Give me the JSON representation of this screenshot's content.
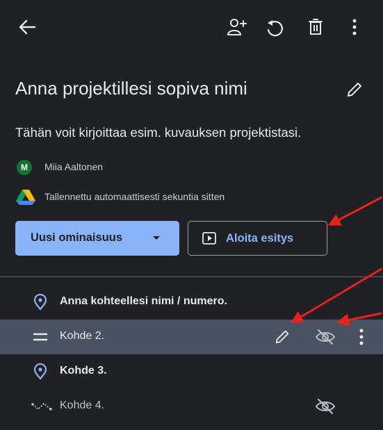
{
  "project": {
    "title": "Anna projektillesi sopiva nimi",
    "description": "Tähän voit kirjoittaa esim. kuvauksen projektistasi.",
    "author_initial": "M",
    "author_name": "Miia Aaltonen",
    "save_status": "Tallennettu automaattisesti sekuntia sitten"
  },
  "toolbar": {
    "icons": [
      "back-arrow-icon",
      "add-person-icon",
      "undo-icon",
      "trash-icon",
      "more-vert-icon"
    ]
  },
  "buttons": {
    "new_feature": "Uusi ominaisuus",
    "present": "Aloita esitys"
  },
  "items": [
    {
      "label": "Anna kohteellesi nimi / numero.",
      "icon": "location-pin-icon",
      "bold": true
    },
    {
      "label": "Kohde 2.",
      "icon": "drag-handle-icon",
      "bold": false,
      "selected": true,
      "actions": [
        "edit-pencil-icon",
        "visibility-off-icon",
        "more-vert-icon"
      ]
    },
    {
      "label": "Kohde 3.",
      "icon": "location-pin-icon",
      "bold": true
    },
    {
      "label": "Kohde 4.",
      "icon": "path-line-icon",
      "bold": false,
      "actions": [
        "visibility-off-icon"
      ]
    }
  ],
  "colors": {
    "background": "#202124",
    "accent": "#8ab4f8",
    "selected_row": "#4a5261",
    "annotation_arrow": "#e8221a",
    "avatar": "#137333"
  }
}
